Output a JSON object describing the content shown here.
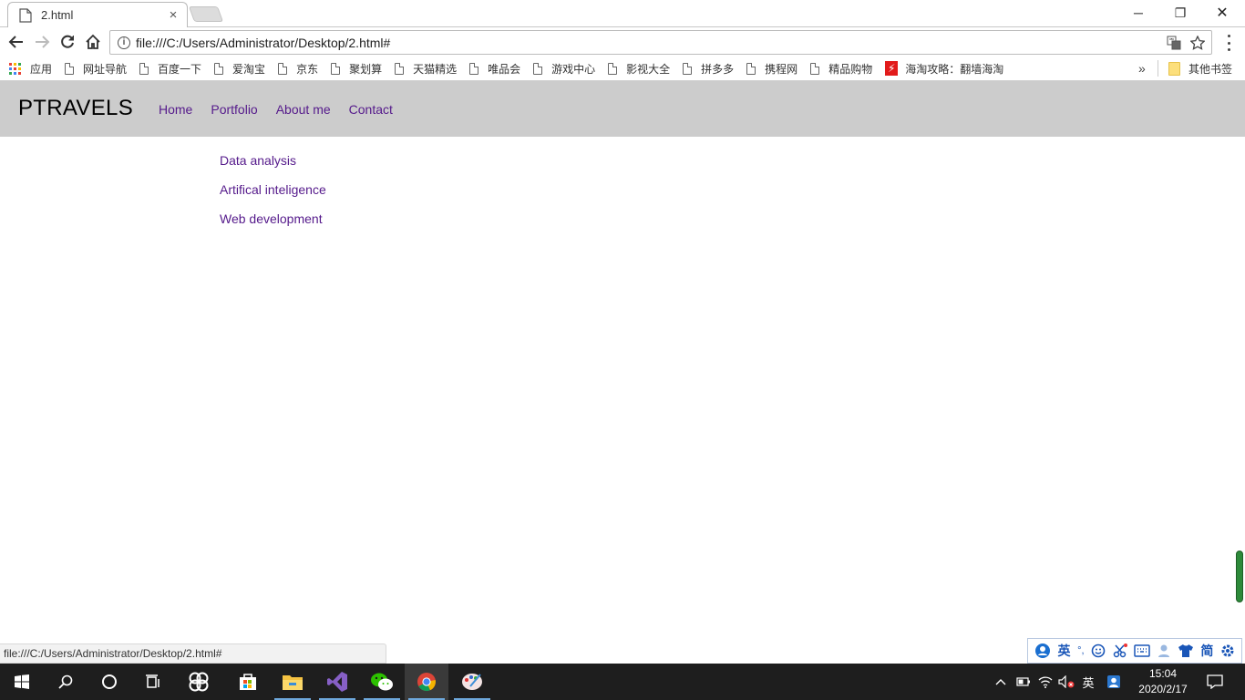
{
  "browser": {
    "tab_title": "2.html",
    "tab_close": "×",
    "url": "file:///C:/Users/Administrator/Desktop/2.html#",
    "window_controls": {
      "minimize": "─",
      "restore": "❐",
      "close": "✕"
    }
  },
  "bookmarks": {
    "items": [
      "应用",
      "网址导航",
      "百度一下",
      "爱淘宝",
      "京东",
      "聚划算",
      "天猫精选",
      "唯品会",
      "游戏中心",
      "影视大全",
      "拼多多",
      "携程网",
      "精品购物",
      "海淘攻略：翻墙海淘"
    ],
    "more": "»",
    "other": "其他书签"
  },
  "site": {
    "logo": "PTRAVELS",
    "nav": [
      "Home",
      "Portfolio",
      "About me",
      "Contact"
    ],
    "submenu": [
      "Data analysis",
      "Artifical inteligence",
      "Web development"
    ],
    "link_color": "#551a8b",
    "header_bg": "#cccccc"
  },
  "status_bar": {
    "text": "file:///C:/Users/Administrator/Desktop/2.html#"
  },
  "ime": {
    "lang": "英",
    "punct": "°,",
    "simplified": "简"
  },
  "taskbar": {
    "tray_lang": "英",
    "time": "15:04",
    "date": "2020/2/17"
  }
}
